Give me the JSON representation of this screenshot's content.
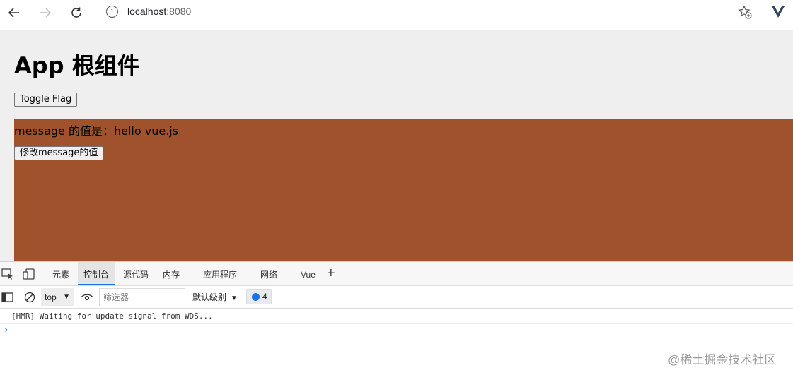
{
  "browser": {
    "url_host": "localhost",
    "url_port": ":8080",
    "info_icon": "i"
  },
  "page": {
    "title": "App 根组件",
    "toggle_button": "Toggle Flag",
    "message_text": "message 的值是：hello vue.js",
    "modify_button": "修改message的值",
    "child_bg_color": "#a0522d"
  },
  "devtools": {
    "tabs": [
      "元素",
      "控制台",
      "源代码",
      "内存",
      "应用程序",
      "网络",
      "Vue"
    ],
    "active_tab": "控制台",
    "add_tab": "+",
    "context": "top",
    "filter_placeholder": "筛选器",
    "levels": "默认级别",
    "issues_count": "4",
    "console_log": "[HMR] Waiting for update signal from WDS...",
    "prompt": "›"
  },
  "watermark": "@稀土掘金技术社区"
}
